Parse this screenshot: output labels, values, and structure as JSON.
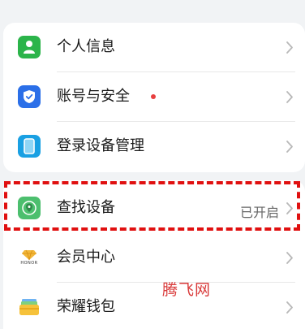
{
  "colors": {
    "background": "#f1f3f5",
    "card": "#ffffff",
    "personal_icon": "#2bb44a",
    "security_icon": "#2b6fe8",
    "login_icon": "#19a0e3",
    "find_icon": "#4cbf6e",
    "highlight": "#e01010",
    "red_dot": "#e84040"
  },
  "section_account": {
    "items": [
      {
        "label": "个人信息",
        "icon": "person-icon"
      },
      {
        "label": "账号与安全",
        "icon": "shield-check-icon",
        "has_red_dot": true
      },
      {
        "label": "登录设备管理",
        "icon": "phone-icon"
      }
    ]
  },
  "section_services": {
    "items": [
      {
        "label": "查找设备",
        "icon": "location-pin-icon",
        "status": "已开启",
        "highlighted": true
      },
      {
        "label": "会员中心",
        "icon": "honor-diamond-icon",
        "icon_caption": "HONOR"
      },
      {
        "label": "荣耀钱包",
        "icon": "wallet-icon"
      }
    ]
  },
  "watermark": "腾飞网"
}
